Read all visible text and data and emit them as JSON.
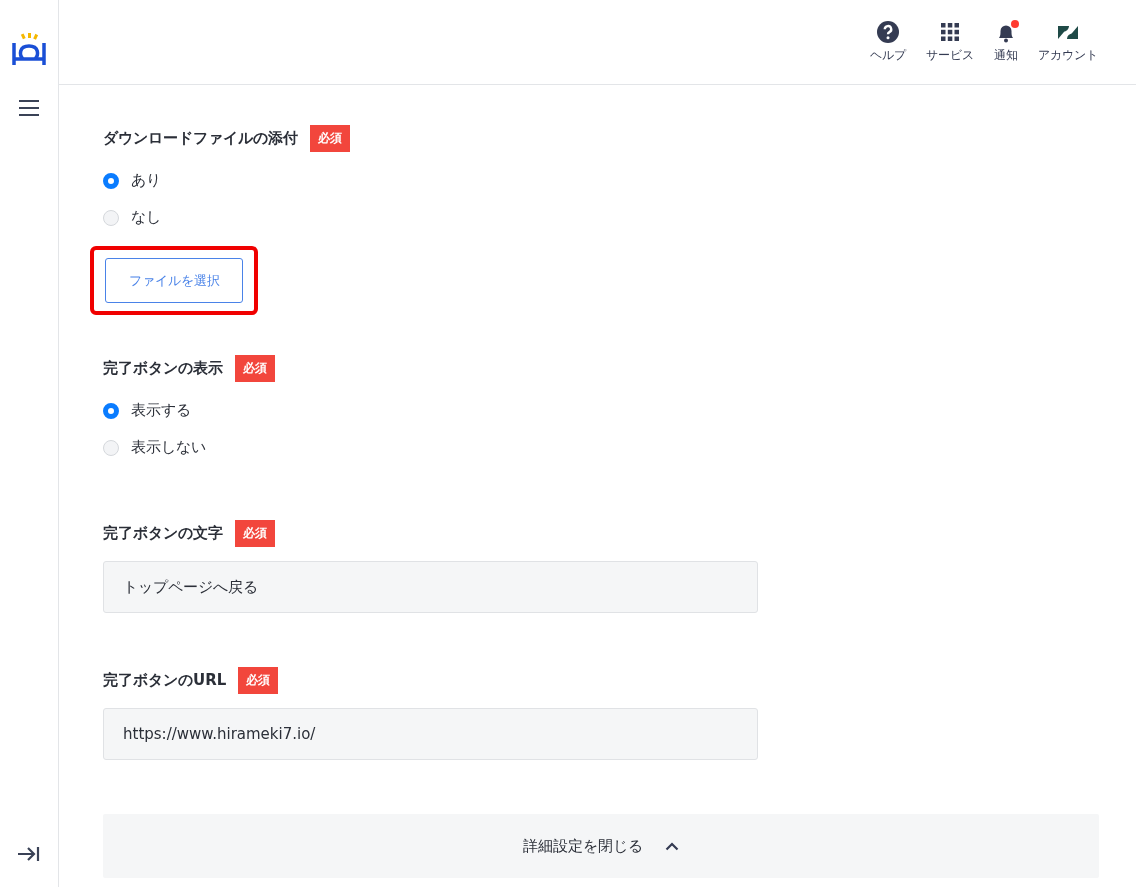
{
  "header": {
    "items": [
      {
        "kind": "help",
        "label": "ヘルプ",
        "badge": false
      },
      {
        "kind": "grid",
        "label": "サービス",
        "badge": false
      },
      {
        "kind": "bell",
        "label": "通知",
        "badge": true
      },
      {
        "kind": "account",
        "label": "アカウント",
        "badge": false
      }
    ]
  },
  "sections": [
    {
      "kind": "radio",
      "label": "ダウンロードファイルの添付",
      "required": "必須",
      "options": [
        {
          "label": "あり",
          "selected": true
        },
        {
          "label": "なし",
          "selected": false
        }
      ],
      "button": {
        "label": "ファイルを選択",
        "highlighted": true
      }
    },
    {
      "kind": "radio",
      "label": "完了ボタンの表示",
      "required": "必須",
      "options": [
        {
          "label": "表示する",
          "selected": true
        },
        {
          "label": "表示しない",
          "selected": false
        }
      ]
    },
    {
      "kind": "text",
      "label": "完了ボタンの文字",
      "required": "必須",
      "value": "トップページへ戻る"
    },
    {
      "kind": "text",
      "label": "完了ボタンのURL",
      "required": "必須",
      "value": "https://www.hirameki7.io/"
    }
  ],
  "collapse_bar": {
    "label": "詳細設定を閉じる",
    "expanded": true
  }
}
